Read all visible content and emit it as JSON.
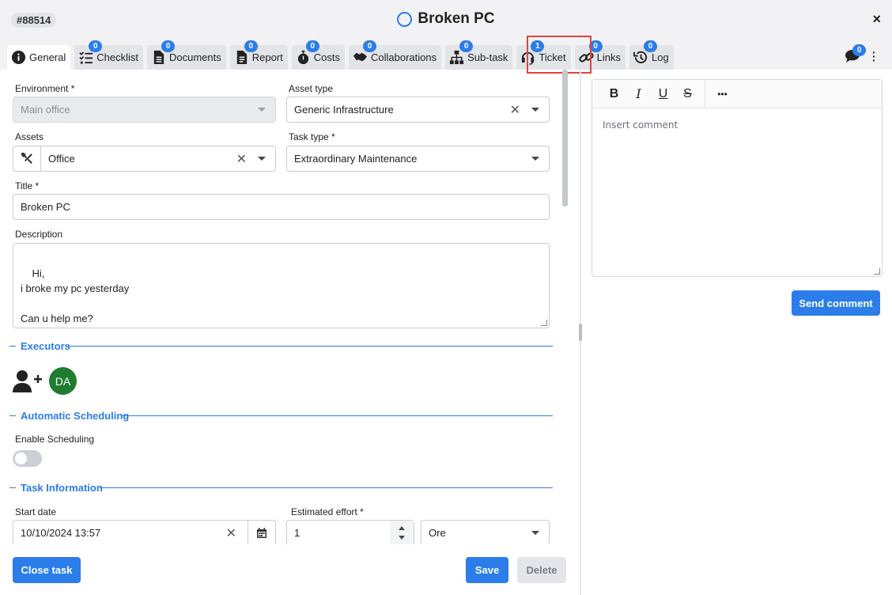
{
  "header": {
    "ticket_id": "#88514",
    "title": "Broken PC",
    "close_glyph": "×"
  },
  "tabs": [
    {
      "label": "General",
      "icon": "info-icon",
      "badge": null,
      "active": true
    },
    {
      "label": "Checklist",
      "icon": "checklist-icon",
      "badge": "0"
    },
    {
      "label": "Documents",
      "icon": "document-icon",
      "badge": "0"
    },
    {
      "label": "Report",
      "icon": "report-icon",
      "badge": "0"
    },
    {
      "label": "Costs",
      "icon": "stopwatch-icon",
      "badge": "0"
    },
    {
      "label": "Collaborations",
      "icon": "handshake-icon",
      "badge": "0"
    },
    {
      "label": "Sub-task",
      "icon": "sitemap-icon",
      "badge": "0"
    },
    {
      "label": "Ticket",
      "icon": "headset-icon",
      "badge": "1"
    },
    {
      "label": "Links",
      "icon": "link-icon",
      "badge": "0"
    },
    {
      "label": "Log",
      "icon": "history-icon",
      "badge": "0"
    }
  ],
  "chat_badge": "0",
  "form": {
    "environment": {
      "label": "Environment *",
      "value": "Main office"
    },
    "asset_type": {
      "label": "Asset type",
      "value": "Generic Infrastructure"
    },
    "assets": {
      "label": "Assets",
      "value": "Office"
    },
    "task_type": {
      "label": "Task type *",
      "value": "Extraordinary Maintenance"
    },
    "title": {
      "label": "Title *",
      "value": "Broken PC"
    },
    "description": {
      "label": "Description",
      "value": "Hi,\ni broke my pc yesterday\n\nCan u help me?"
    },
    "executors": {
      "section": "Executors",
      "avatar_initials": "DA"
    },
    "scheduling": {
      "section": "Automatic Scheduling",
      "toggle_label": "Enable Scheduling",
      "enabled": false
    },
    "task_info": {
      "section": "Task Information"
    },
    "start_date": {
      "label": "Start date",
      "value": "10/10/2024 13:57"
    },
    "estimated_effort": {
      "label": "Estimated effort *",
      "value": "1",
      "unit": "Ore"
    }
  },
  "footer": {
    "close_task": "Close task",
    "save": "Save",
    "delete": "Delete"
  },
  "comment": {
    "placeholder": "Insert comment",
    "bold": "B",
    "italic": "I",
    "underline": "U",
    "strike": "S",
    "more": "•••",
    "send": "Send comment"
  },
  "colors": {
    "accent": "#2b7de9",
    "avatar": "#1e7d2f",
    "highlight": "#e0443e"
  }
}
